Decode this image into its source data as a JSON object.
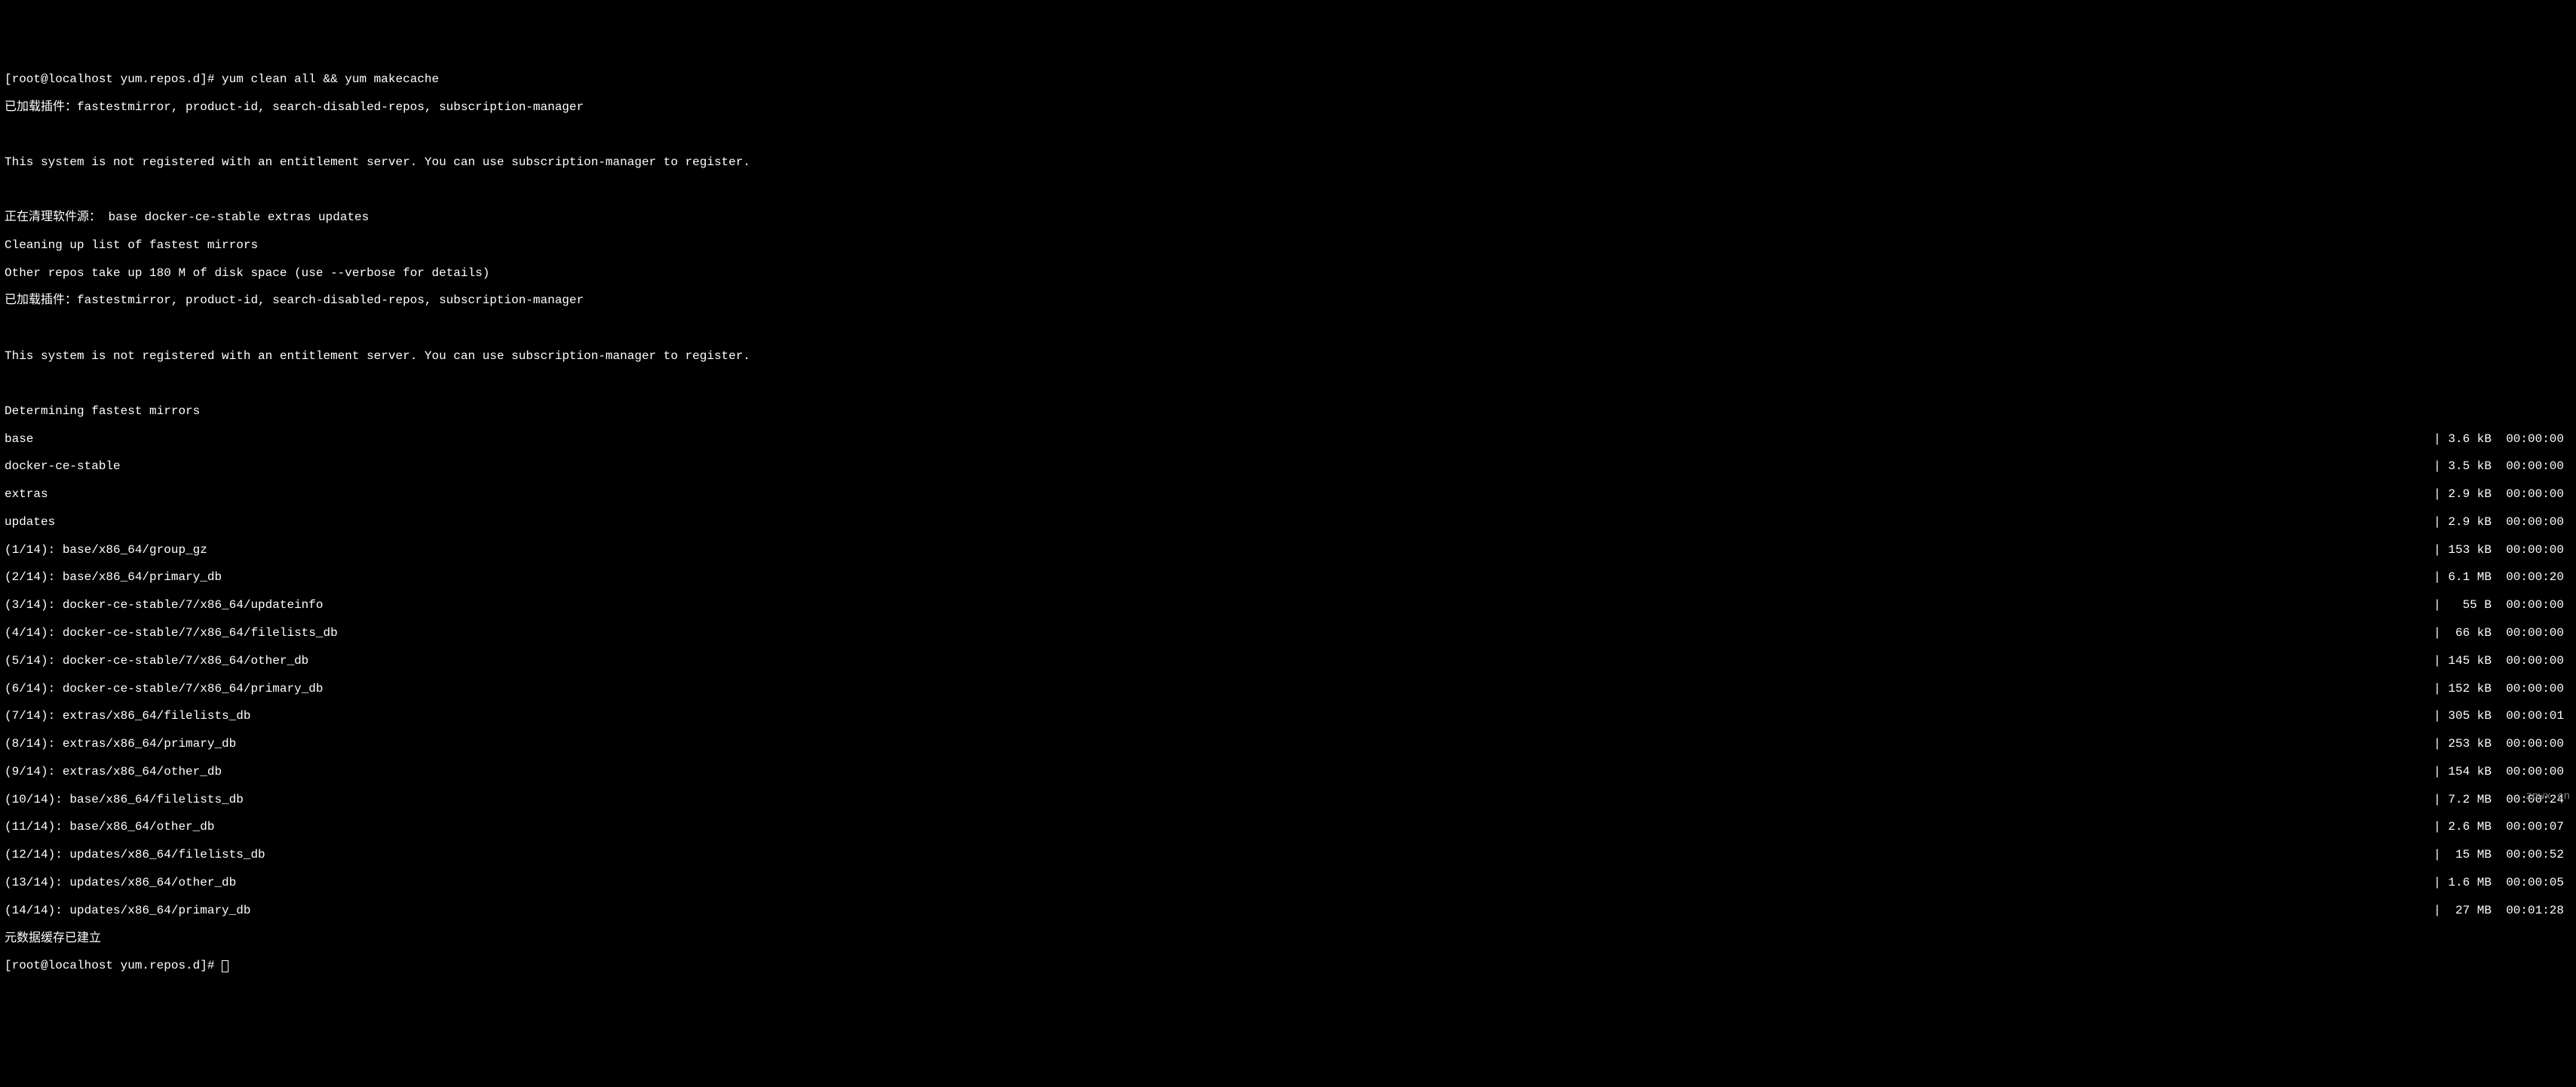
{
  "prompt1": "[root@localhost yum.repos.d]# ",
  "command1": "yum clean all && yum makecache",
  "plugins_loaded": "已加载插件：fastestmirror, product-id, search-disabled-repos, subscription-manager",
  "not_registered": "This system is not registered with an entitlement server. You can use subscription-manager to register.",
  "cleaning_sources": "正在清理软件源： base docker-ce-stable extras updates",
  "cleaning_mirrors": "Cleaning up list of fastest mirrors",
  "other_repos": "Other repos take up 180 M of disk space (use --verbose for details)",
  "determining": "Determining fastest mirrors",
  "repos": [
    {
      "name": "base",
      "size": "| 3.6 kB  00:00:00"
    },
    {
      "name": "docker-ce-stable",
      "size": "| 3.5 kB  00:00:00"
    },
    {
      "name": "extras",
      "size": "| 2.9 kB  00:00:00"
    },
    {
      "name": "updates",
      "size": "| 2.9 kB  00:00:00"
    }
  ],
  "downloads": [
    {
      "name": "(1/14): base/x86_64/group_gz",
      "size": "| 153 kB  00:00:00"
    },
    {
      "name": "(2/14): base/x86_64/primary_db",
      "size": "| 6.1 MB  00:00:20"
    },
    {
      "name": "(3/14): docker-ce-stable/7/x86_64/updateinfo",
      "size": "|   55 B  00:00:00"
    },
    {
      "name": "(4/14): docker-ce-stable/7/x86_64/filelists_db",
      "size": "|  66 kB  00:00:00"
    },
    {
      "name": "(5/14): docker-ce-stable/7/x86_64/other_db",
      "size": "| 145 kB  00:00:00"
    },
    {
      "name": "(6/14): docker-ce-stable/7/x86_64/primary_db",
      "size": "| 152 kB  00:00:00"
    },
    {
      "name": "(7/14): extras/x86_64/filelists_db",
      "size": "| 305 kB  00:00:01"
    },
    {
      "name": "(8/14): extras/x86_64/primary_db",
      "size": "| 253 kB  00:00:00"
    },
    {
      "name": "(9/14): extras/x86_64/other_db",
      "size": "| 154 kB  00:00:00"
    },
    {
      "name": "(10/14): base/x86_64/filelists_db",
      "size": "| 7.2 MB  00:00:24"
    },
    {
      "name": "(11/14): base/x86_64/other_db",
      "size": "| 2.6 MB  00:00:07"
    },
    {
      "name": "(12/14): updates/x86_64/filelists_db",
      "size": "|  15 MB  00:00:52"
    },
    {
      "name": "(13/14): updates/x86_64/other_db",
      "size": "| 1.6 MB  00:00:05"
    },
    {
      "name": "(14/14): updates/x86_64/primary_db",
      "size": "|  27 MB  00:01:28"
    }
  ],
  "cache_created": "元数据缓存已建立",
  "prompt2": "[root@localhost yum.repos.d]# ",
  "watermark": "znwx.cn"
}
